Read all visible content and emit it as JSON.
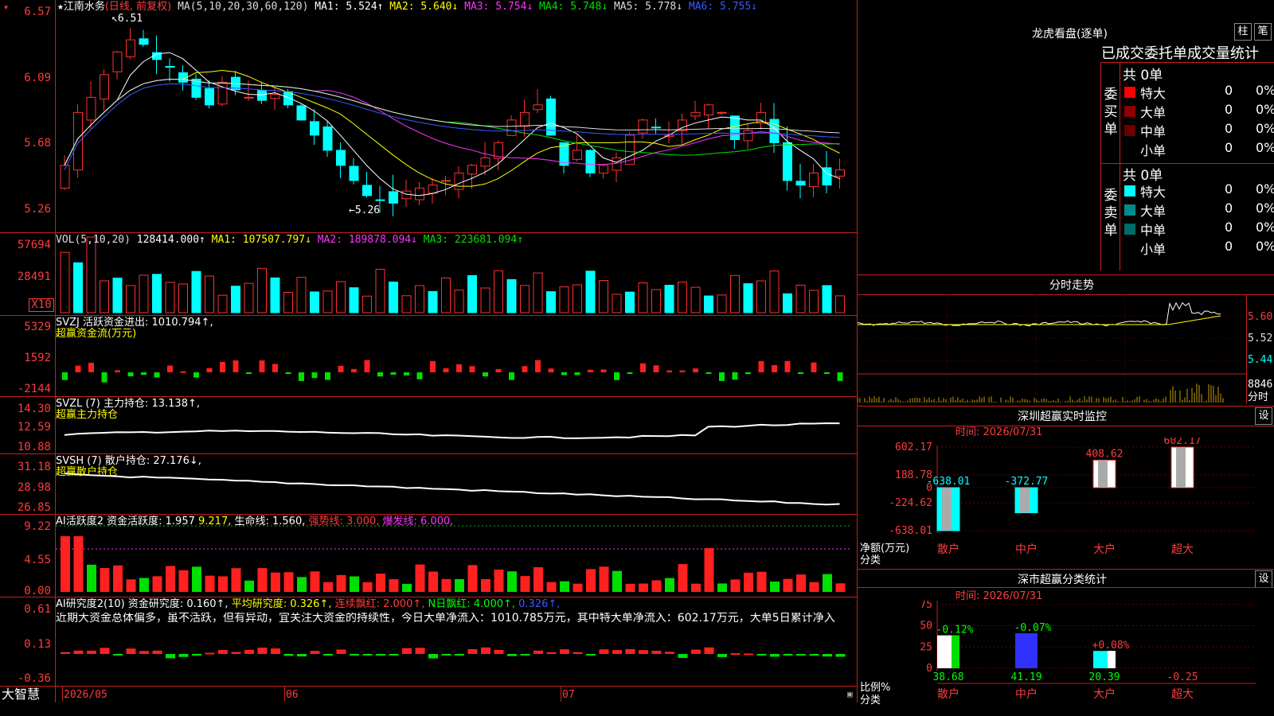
{
  "stock": {
    "star": "★",
    "name": "江南水务",
    "period": "(日线, 前复权)",
    "ma_head": "MA(5,10,20,30,60,120)",
    "ma": [
      {
        "label": "MA1: 5.524↑",
        "color": "#ffffff"
      },
      {
        "label": "MA2: 5.640↓",
        "color": "#ffff00"
      },
      {
        "label": "MA3: 5.754↓",
        "color": "#ff33ff"
      },
      {
        "label": "MA4: 5.748↓",
        "color": "#00e000"
      },
      {
        "label": "MA5: 5.778↓",
        "color": "#dddddd"
      },
      {
        "label": "MA6: 5.755↓",
        "color": "#3a5aff"
      }
    ],
    "hi_label": "6.51",
    "lo_label": "←5.26",
    "y_labels": [
      "6.57",
      "6.09",
      "5.68",
      "5.26"
    ]
  },
  "vol": {
    "head": "VOL(5,10,20)",
    "value": "128414.000↑",
    "ma": [
      {
        "label": "MA1: 107507.797↓",
        "color": "#ffff00"
      },
      {
        "label": "MA2: 189878.094↓",
        "color": "#ff33ff"
      },
      {
        "label": "MA3: 223681.094↑",
        "color": "#00e000"
      }
    ],
    "y_labels": [
      "57694",
      "28491",
      "X10"
    ]
  },
  "svzj": {
    "head": "SVZJ  活跃资金进出: 1010.794↑,",
    "sub": "超赢资金流(万元)",
    "y_labels": [
      "5329",
      "1592",
      "-2144"
    ]
  },
  "svzl": {
    "head": "SVZL  (7) 主力持仓: 13.138↑,",
    "sub": "超赢主力持仓",
    "y_labels": [
      "14.30",
      "12.59",
      "10.88"
    ]
  },
  "svsh": {
    "head": "SVSH  (7) 散户持仓: 27.176↓,",
    "sub": "超赢散户持仓",
    "y_labels": [
      "31.18",
      "28.98",
      "26.85"
    ]
  },
  "ai1": {
    "head": "AI活跃度2 资金活跃度: 1.957",
    "v2": "9.217,",
    "v3": "生命线: 1.560,",
    "v4": "强势线: 3.000,",
    "v5": "爆发线: 6.000,",
    "y_labels": [
      "9.22",
      "4.55",
      "0.00"
    ]
  },
  "ai2": {
    "head": "AI研究度2(10) 资金研究度: 0.160↑,",
    "v2": "平均研究度: 0.326↑,",
    "v3": "连续飘红: 2.000↑,",
    "v4": "N日飘红: 4.000↑,",
    "v5": "0.326↑,",
    "text": "近期大资金总体偏多，虽不活跃，但有异动，宜关注大资金的持续性，今日大单净流入：1010.785万元，其中特大单净流入：602.17万元，大单5日累计净入",
    "y_labels": [
      "0.61",
      "0.13",
      "-0.36"
    ]
  },
  "footer": {
    "brand": "大智慧",
    "dates": [
      "2026/05",
      "06",
      "07"
    ]
  },
  "longhu": {
    "title": "龙虎看盘(逐单)",
    "btn_zhu": "柱",
    "btn_bi": "笔",
    "tabs": "已成交委托单成交量统计",
    "buy_total": "共 0单",
    "sell_total": "共 0单",
    "buy_label": "委买单",
    "sell_label": "委卖单",
    "buy_rows": [
      {
        "name": "特大",
        "color": "#ff0000",
        "count": "0",
        "pct": "0%"
      },
      {
        "name": "大单",
        "color": "#8b0000",
        "count": "0",
        "pct": "0%"
      },
      {
        "name": "中单",
        "color": "#6a0000",
        "count": "0",
        "pct": "0%"
      },
      {
        "name": "小单",
        "color": "",
        "count": "0",
        "pct": "0%"
      }
    ],
    "sell_rows": [
      {
        "name": "特大",
        "color": "#00ffff",
        "count": "0",
        "pct": "0%"
      },
      {
        "name": "大单",
        "color": "#008b8b",
        "count": "0",
        "pct": "0%"
      },
      {
        "name": "中单",
        "color": "#006b6b",
        "count": "0",
        "pct": "0%"
      },
      {
        "name": "小单",
        "color": "",
        "count": "0",
        "pct": "0%"
      }
    ]
  },
  "fenshi": {
    "title": "分时走势",
    "prices": [
      "5.60",
      "5.52",
      "5.44"
    ],
    "vol": "8846",
    "vol_unit": "分时"
  },
  "szmon": {
    "title": "深圳超赢实时监控",
    "set": "设",
    "time": "时间: 2026/07/31",
    "y_labels": [
      "602.17",
      "188.78",
      "0",
      "-224.62",
      "-638.01"
    ],
    "unit": "净额(万元)",
    "cat_label": "分类",
    "cats": [
      "散户",
      "中户",
      "大户",
      "超大"
    ],
    "values": [
      -638.01,
      -372.77,
      408.62,
      602.17
    ],
    "value_labels": [
      "-638.01",
      "-372.77",
      "408.62",
      "602.17"
    ]
  },
  "szcls": {
    "title": "深市超赢分类统计",
    "set": "设",
    "time": "时间: 2026/07/31",
    "y_labels": [
      "75",
      "50",
      "25",
      "0"
    ],
    "unit": "比例%",
    "cat_label": "分类",
    "cats": [
      "散户",
      "中户",
      "大户",
      "超大"
    ],
    "percents": [
      38.68,
      41.19,
      20.39,
      -0.25
    ],
    "pct_labels": [
      "38.68",
      "41.19",
      "20.39",
      "-0.25"
    ],
    "changes": [
      "-0.12%",
      "-0.07%",
      "+0.08%",
      ""
    ]
  }
}
